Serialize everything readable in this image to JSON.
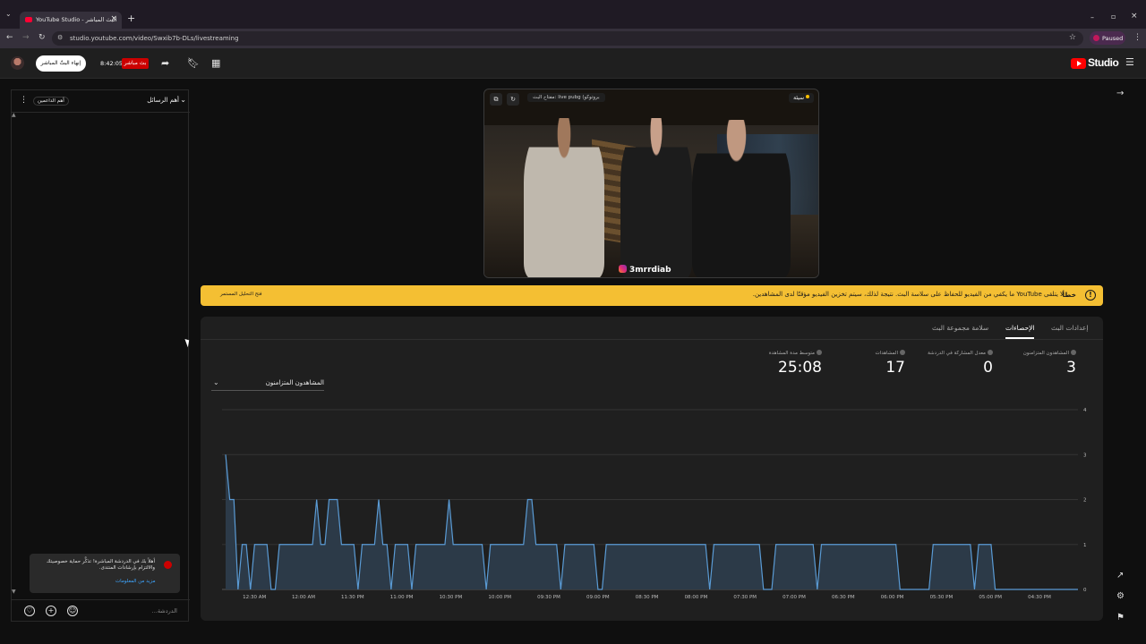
{
  "browser": {
    "tab_title": "YouTube Studio - البث المباشر",
    "url": "studio.youtube.com/video/Swxib7b-DLs/livestreaming",
    "profile_status": "Paused",
    "brand_color": "#ff0033"
  },
  "header": {
    "logo_text": "Studio",
    "end_stream_label": "إنهاء البثّ المباشر",
    "elapsed_time": "8:42:05",
    "live_badge": "بث مباشر"
  },
  "chat": {
    "title": "أهم الرسائل",
    "sponsor_label": "أهم الداعمين",
    "banner_text": "أهلاً بك في الدردشة المباشرة! تذكَّر حماية خصوصيتك والالتزام بإرشادات المنتدى.",
    "banner_link": "مزيد من المعلومات",
    "input_placeholder": "الدردشة..."
  },
  "preview": {
    "stream_key_label": "مفتاح البث: live pubg (بروتوكو",
    "quality_label": "سيئة",
    "overlay_tag": "3mrrdiab"
  },
  "warning": {
    "label": "خطأ",
    "message": "لا يتلقى YouTube ما يكفي من الفيديو للحفاظ على سلاسة البث. نتيجة لذلك، سيتم تخزين الفيديو مؤقتًا لدى المشاهدين.",
    "link": "فتح التحليل المستمر",
    "color": "#f4bf33"
  },
  "tabs": [
    "إعدادات البث",
    "الإحصاءات",
    "سلامة مجموعة البث"
  ],
  "active_tab": "الإحصاءات",
  "stats": [
    {
      "label": "المشاهدون المتزامنون",
      "value": "3"
    },
    {
      "label": "معدل المشاركة في الدردشة",
      "value": "0"
    },
    {
      "label": "المشاهدات",
      "value": "17"
    },
    {
      "label": "متوسط مدة المشاهدة",
      "value": "25:08"
    }
  ],
  "metric_select": "المشاهدون المتزامنون",
  "chart_data": {
    "type": "area",
    "x_ticks": [
      "04:30 PM",
      "05:00 PM",
      "05:30 PM",
      "06:00 PM",
      "06:30 PM",
      "07:00 PM",
      "07:30 PM",
      "08:00 PM",
      "08:30 PM",
      "09:00 PM",
      "09:30 PM",
      "10:00 PM",
      "10:30 PM",
      "11:00 PM",
      "11:30 PM",
      "12:00 AM",
      "12:30 AM"
    ],
    "y_ticks": [
      "0",
      "1",
      "2",
      "3",
      "4"
    ],
    "ylim": [
      0,
      4
    ],
    "x_direction": "right-to-left",
    "line_color": "#5a9bd5",
    "fill_color": "#2c3a48",
    "series": [
      {
        "values": [
          3,
          2,
          2,
          0,
          1,
          1,
          0,
          1,
          1,
          1,
          1,
          0,
          0,
          1,
          1,
          1,
          1,
          1,
          1,
          1,
          1,
          1,
          2,
          1,
          1,
          2,
          2,
          2,
          1,
          1,
          1,
          1,
          0,
          1,
          1,
          1,
          1,
          2,
          1,
          1,
          0,
          1,
          1,
          1,
          1,
          0,
          1,
          1,
          1,
          1,
          1,
          1,
          1,
          1,
          2,
          1,
          1,
          1,
          1,
          1,
          1,
          1,
          1,
          0,
          1,
          1,
          1,
          1,
          1,
          1,
          1,
          1,
          1,
          2,
          2,
          1,
          1,
          1,
          1,
          1,
          1,
          0,
          1,
          1,
          1,
          1,
          1,
          1,
          1,
          1,
          0,
          0,
          1,
          1,
          1,
          1,
          1,
          1,
          1,
          1,
          1,
          1,
          1,
          1,
          1,
          1,
          1,
          1,
          1,
          1,
          1,
          1,
          1,
          1,
          1,
          1,
          1,
          0,
          1,
          1,
          1,
          1,
          1,
          1,
          1,
          1,
          1,
          1,
          1,
          1,
          0,
          0,
          0,
          1,
          1,
          1,
          1,
          1,
          1,
          1,
          1,
          1,
          1,
          0,
          1,
          1,
          1,
          1,
          1,
          1,
          1,
          1,
          1,
          1,
          1,
          1,
          1,
          1,
          1,
          1,
          1,
          1,
          1,
          0,
          0,
          0,
          0,
          0,
          0,
          0,
          0,
          1,
          1,
          1,
          1,
          1,
          1,
          1,
          1,
          1,
          1,
          0,
          1,
          1,
          1,
          1,
          0,
          0,
          0,
          0,
          0,
          0,
          0,
          0,
          0,
          0,
          0,
          0,
          0,
          0,
          0,
          0,
          0,
          0,
          0,
          0,
          0
        ]
      }
    ]
  }
}
